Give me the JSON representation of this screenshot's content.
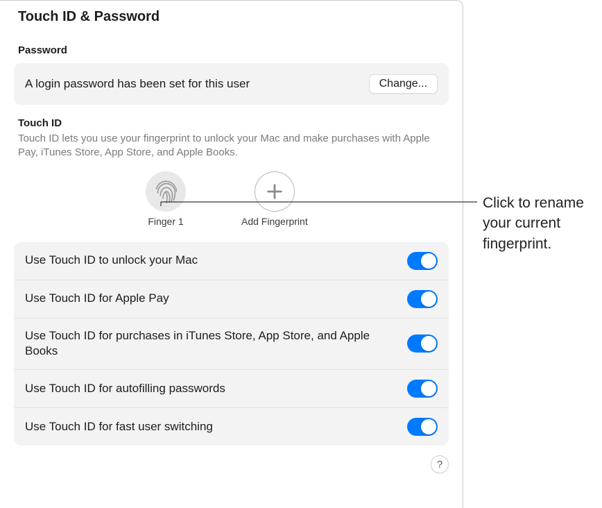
{
  "pageTitle": "Touch ID & Password",
  "password": {
    "sectionLabel": "Password",
    "statusText": "A login password has been set for this user",
    "changeLabel": "Change..."
  },
  "touchId": {
    "title": "Touch ID",
    "description": "Touch ID lets you use your fingerprint to unlock your Mac and make purchases with Apple Pay, iTunes Store, App Store, and Apple Books.",
    "finger1Label": "Finger 1",
    "addFingerprintLabel": "Add Fingerprint"
  },
  "toggles": [
    {
      "label": "Use Touch ID to unlock your Mac",
      "on": true
    },
    {
      "label": "Use Touch ID for Apple Pay",
      "on": true
    },
    {
      "label": "Use Touch ID for purchases in iTunes Store, App Store, and Apple Books",
      "on": true
    },
    {
      "label": "Use Touch ID for autofilling passwords",
      "on": true
    },
    {
      "label": "Use Touch ID for fast user switching",
      "on": true
    }
  ],
  "helpLabel": "?",
  "annotation": "Click to rename your current fingerprint."
}
